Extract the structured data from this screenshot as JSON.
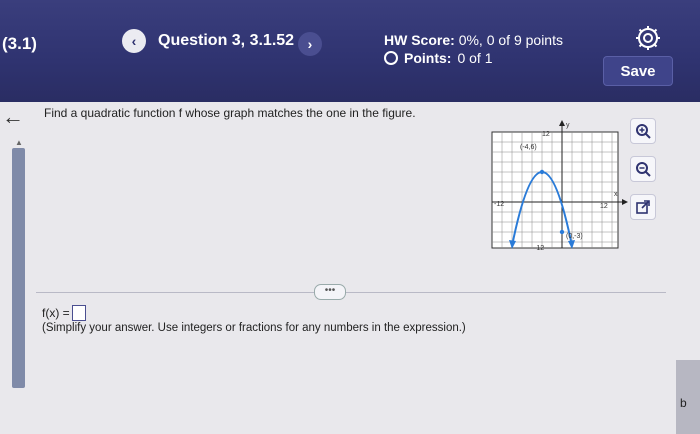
{
  "header": {
    "section": "(3.1)",
    "prev_label": "‹",
    "question_title": "Question 3, 3.1.52",
    "next_label": "›",
    "hw_score_label": "HW Score:",
    "hw_score_value": "0%, 0 of 9 points",
    "points_label": "Points:",
    "points_value": "0 of 1",
    "save_label": "Save"
  },
  "prompt": "Find a quadratic function f whose graph matches the one in the figure.",
  "figure": {
    "y_axis_label": "y",
    "x_axis_label": "x",
    "tick_y_top": "12",
    "tick_x_left": "-12",
    "tick_x_right": "12",
    "tick_y_bottom": "-12",
    "point_top": "(-4,6)",
    "point_bottom": "(0,-3)"
  },
  "more_label": "•••",
  "answer": {
    "prefix": "f(x) =",
    "hint": "(Simplify your answer. Use integers or fractions for any numbers in the expression.)"
  },
  "edge_label": "b",
  "colors": {
    "header": "#2f3370",
    "graph_line": "#2a7bd8"
  }
}
